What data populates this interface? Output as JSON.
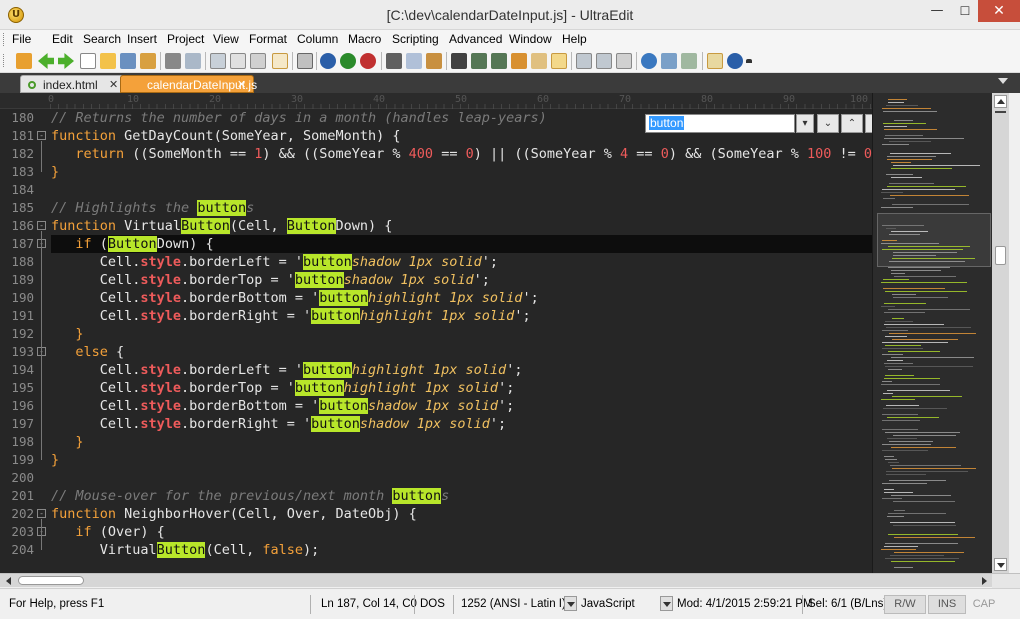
{
  "window": {
    "title": "[C:\\dev\\calendarDateInput.js] - UltraEdit",
    "app_icon_letter": "U",
    "minimize": "—",
    "maximize": "☐",
    "close": "✕"
  },
  "menu": [
    "File",
    "Edit",
    "Search",
    "Insert",
    "Project",
    "View",
    "Format",
    "Column",
    "Macro",
    "Scripting",
    "Advanced",
    "Window",
    "Help"
  ],
  "tabs": [
    {
      "label": "index.html",
      "close": "✕",
      "active": false
    },
    {
      "label": "calendarDateInput.js",
      "close": "✕",
      "active": true
    }
  ],
  "ruler": [
    "0",
    "10",
    "20",
    "30",
    "40",
    "50",
    "60",
    "70",
    "80",
    "90",
    "100"
  ],
  "find": {
    "value": "button",
    "next": "⌄",
    "prev": "⌃",
    "more": "…"
  },
  "code": {
    "current_line": 187,
    "lines": [
      {
        "n": "180",
        "fold": "",
        "segs": [
          [
            "cm",
            "// Returns the number of days in a month (handles leap-years)"
          ]
        ]
      },
      {
        "n": "181",
        "fold": "-",
        "segs": [
          [
            "kw",
            "function"
          ],
          [
            "fn",
            " GetDayCount(SomeYear, SomeMonth) {"
          ]
        ]
      },
      {
        "n": "182",
        "fold": "",
        "segs": [
          [
            "op",
            "   "
          ],
          [
            "kw",
            "return"
          ],
          [
            "op",
            " ((SomeMonth == "
          ],
          [
            "num",
            "1"
          ],
          [
            "op",
            ") && ((SomeYear % "
          ],
          [
            "num",
            "400"
          ],
          [
            "op",
            " == "
          ],
          [
            "num",
            "0"
          ],
          [
            "op",
            ") || ((SomeYear % "
          ],
          [
            "num",
            "4"
          ],
          [
            "op",
            " == "
          ],
          [
            "num",
            "0"
          ],
          [
            "op",
            ") && (SomeYear % "
          ],
          [
            "num",
            "100"
          ],
          [
            "op",
            " != "
          ],
          [
            "num",
            "0"
          ],
          [
            "op",
            ")"
          ]
        ]
      },
      {
        "n": "183",
        "fold": "",
        "segs": [
          [
            "kw",
            "}"
          ]
        ]
      },
      {
        "n": "184",
        "fold": "",
        "segs": []
      },
      {
        "n": "185",
        "fold": "",
        "segs": [
          [
            "cm",
            "// Highlights the "
          ],
          [
            "hlc",
            "button"
          ],
          [
            "cm",
            "s"
          ]
        ]
      },
      {
        "n": "186",
        "fold": "-",
        "segs": [
          [
            "kw",
            "function"
          ],
          [
            "fn",
            " Virtual"
          ],
          [
            "hl",
            "Button"
          ],
          [
            "fn",
            "(Cell, "
          ],
          [
            "hl",
            "Button"
          ],
          [
            "fn",
            "Down) {"
          ]
        ]
      },
      {
        "n": "187",
        "fold": "-",
        "segs": [
          [
            "op",
            "   "
          ],
          [
            "kw",
            "if"
          ],
          [
            "op",
            " ("
          ],
          [
            "hl",
            "Button"
          ],
          [
            "op",
            "Down) {"
          ]
        ]
      },
      {
        "n": "188",
        "fold": "",
        "segs": [
          [
            "op",
            "      Cell."
          ],
          [
            "prop",
            "style"
          ],
          [
            "op",
            ".borderLeft = '"
          ],
          [
            "hl",
            "button"
          ],
          [
            "str",
            "shadow 1px solid"
          ],
          [
            "op",
            "';"
          ]
        ]
      },
      {
        "n": "189",
        "fold": "",
        "segs": [
          [
            "op",
            "      Cell."
          ],
          [
            "prop",
            "style"
          ],
          [
            "op",
            ".borderTop = '"
          ],
          [
            "hl",
            "button"
          ],
          [
            "str",
            "shadow 1px solid"
          ],
          [
            "op",
            "';"
          ]
        ]
      },
      {
        "n": "190",
        "fold": "",
        "segs": [
          [
            "op",
            "      Cell."
          ],
          [
            "prop",
            "style"
          ],
          [
            "op",
            ".borderBottom = '"
          ],
          [
            "hl",
            "button"
          ],
          [
            "str",
            "highlight 1px solid"
          ],
          [
            "op",
            "';"
          ]
        ]
      },
      {
        "n": "191",
        "fold": "",
        "segs": [
          [
            "op",
            "      Cell."
          ],
          [
            "prop",
            "style"
          ],
          [
            "op",
            ".borderRight = '"
          ],
          [
            "hl",
            "button"
          ],
          [
            "str",
            "highlight 1px solid"
          ],
          [
            "op",
            "';"
          ]
        ]
      },
      {
        "n": "192",
        "fold": "",
        "segs": [
          [
            "op",
            "   "
          ],
          [
            "kw",
            "}"
          ]
        ]
      },
      {
        "n": "193",
        "fold": "-",
        "segs": [
          [
            "op",
            "   "
          ],
          [
            "kw",
            "else"
          ],
          [
            "op",
            " {"
          ]
        ]
      },
      {
        "n": "194",
        "fold": "",
        "segs": [
          [
            "op",
            "      Cell."
          ],
          [
            "prop",
            "style"
          ],
          [
            "op",
            ".borderLeft = '"
          ],
          [
            "hl",
            "button"
          ],
          [
            "str",
            "highlight 1px solid"
          ],
          [
            "op",
            "';"
          ]
        ]
      },
      {
        "n": "195",
        "fold": "",
        "segs": [
          [
            "op",
            "      Cell."
          ],
          [
            "prop",
            "style"
          ],
          [
            "op",
            ".borderTop = '"
          ],
          [
            "hl",
            "button"
          ],
          [
            "str",
            "highlight 1px solid"
          ],
          [
            "op",
            "';"
          ]
        ]
      },
      {
        "n": "196",
        "fold": "",
        "segs": [
          [
            "op",
            "      Cell."
          ],
          [
            "prop",
            "style"
          ],
          [
            "op",
            ".borderBottom = '"
          ],
          [
            "hl",
            "button"
          ],
          [
            "str",
            "shadow 1px solid"
          ],
          [
            "op",
            "';"
          ]
        ]
      },
      {
        "n": "197",
        "fold": "",
        "segs": [
          [
            "op",
            "      Cell."
          ],
          [
            "prop",
            "style"
          ],
          [
            "op",
            ".borderRight = '"
          ],
          [
            "hl",
            "button"
          ],
          [
            "str",
            "shadow 1px solid"
          ],
          [
            "op",
            "';"
          ]
        ]
      },
      {
        "n": "198",
        "fold": "",
        "segs": [
          [
            "op",
            "   "
          ],
          [
            "kw",
            "}"
          ]
        ]
      },
      {
        "n": "199",
        "fold": "",
        "segs": [
          [
            "kw",
            "}"
          ]
        ]
      },
      {
        "n": "200",
        "fold": "",
        "segs": []
      },
      {
        "n": "201",
        "fold": "",
        "segs": [
          [
            "cm",
            "// Mouse-over for the previous/next month "
          ],
          [
            "hlc",
            "button"
          ],
          [
            "cm",
            "s"
          ]
        ]
      },
      {
        "n": "202",
        "fold": "-",
        "segs": [
          [
            "kw",
            "function"
          ],
          [
            "fn",
            " NeighborHover(Cell, Over, DateObj) {"
          ]
        ]
      },
      {
        "n": "203",
        "fold": "-",
        "segs": [
          [
            "op",
            "   "
          ],
          [
            "kw",
            "if"
          ],
          [
            "op",
            " (Over) {"
          ]
        ]
      },
      {
        "n": "204",
        "fold": "",
        "segs": [
          [
            "op",
            "      Virtual"
          ],
          [
            "hl",
            "Button"
          ],
          [
            "op",
            "(Cell, "
          ],
          [
            "kw",
            "false"
          ],
          [
            "op",
            ");"
          ]
        ]
      }
    ]
  },
  "status": {
    "help": "For Help, press F1",
    "position": "Ln 187, Col 14, C0",
    "line_ending": "DOS",
    "encoding": "1252  (ANSI - Latin I)",
    "language": "JavaScript",
    "modified": "Mod: 4/1/2015 2:59:21 PM",
    "selection": "Sel: 6/1 (B/Lns)",
    "rw": "R/W",
    "ins": "INS",
    "cap": "CAP"
  },
  "colors": {
    "editor_bg": "#262626",
    "keyword": "#f4a13a",
    "highlight": "#b8e62a",
    "tab_active": "#f4a13a"
  }
}
